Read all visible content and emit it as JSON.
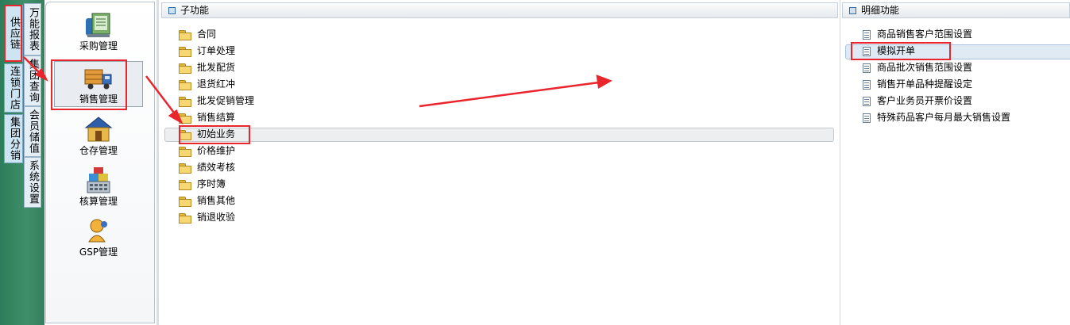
{
  "outer_tabs": [
    {
      "label": "供应链"
    },
    {
      "label": "连锁门店"
    },
    {
      "label": "集团分销"
    }
  ],
  "inner_tabs": [
    {
      "label": "万能报表"
    },
    {
      "label": "集团查询"
    },
    {
      "label": "会员储值"
    },
    {
      "label": "系统设置"
    }
  ],
  "modules": [
    {
      "label": "采购管理",
      "icon": "purchase-icon"
    },
    {
      "label": "销售管理",
      "icon": "sales-truck-icon",
      "selected": true
    },
    {
      "label": "仓存管理",
      "icon": "warehouse-icon"
    },
    {
      "label": "核算管理",
      "icon": "accounting-icon"
    },
    {
      "label": "GSP管理",
      "icon": "gsp-person-icon"
    }
  ],
  "sub_panel": {
    "title": "子功能",
    "items": [
      {
        "label": "合同"
      },
      {
        "label": "订单处理"
      },
      {
        "label": "批发配货"
      },
      {
        "label": "退货红冲"
      },
      {
        "label": "批发促销管理"
      },
      {
        "label": "销售结算"
      },
      {
        "label": "初始业务",
        "selected": true
      },
      {
        "label": "价格维护"
      },
      {
        "label": "绩效考核"
      },
      {
        "label": "序时簿"
      },
      {
        "label": "销售其他"
      },
      {
        "label": "销退收验"
      }
    ]
  },
  "detail_panel": {
    "title": "明细功能",
    "items": [
      {
        "label": "商品销售客户范围设置"
      },
      {
        "label": "模拟开单",
        "selected": true
      },
      {
        "label": "商品批次销售范围设置"
      },
      {
        "label": "销售开单品种提醒设定"
      },
      {
        "label": "客户业务员开票价设置"
      },
      {
        "label": "特殊药品客户每月最大销售设置"
      }
    ]
  },
  "colors": {
    "annotation": "#e8262b",
    "frame_green": "#3f8f6a"
  }
}
